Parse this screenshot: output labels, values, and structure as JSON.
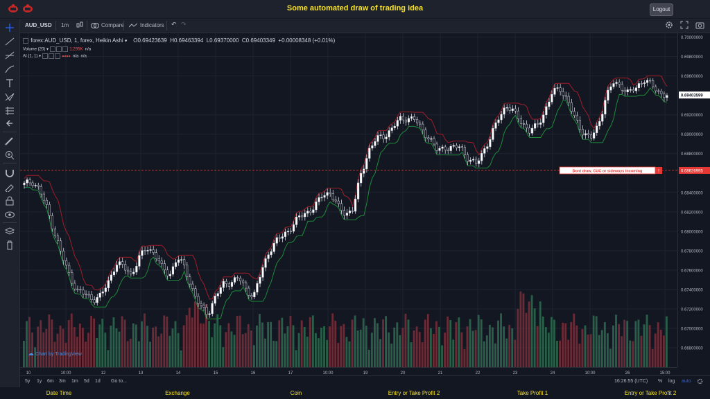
{
  "header": {
    "title": "Some automated draw of trading idea",
    "logout_label": "Logout"
  },
  "toolbar": {
    "symbol": "AUD_USD",
    "interval": "1m",
    "compare_label": "Compare",
    "indicators_label": "Indicators"
  },
  "legend": {
    "main": "forex:AUD_USD, 1, forex, Heikin Ashi",
    "o_label": "O",
    "o": "0.69423639",
    "h_label": "H",
    "h": "0.69463394",
    "l_label": "L",
    "l": "0.69370000",
    "c_label": "C",
    "c": "0.69403349",
    "change": "+0.00008348 (+0.01%)",
    "volume_label": "Volume (20)",
    "volume_value": "1.295K",
    "na1": "n/a",
    "ai_label": "AI (1, 1)",
    "na2": "n/a",
    "na3": "n/a"
  },
  "annotation": {
    "text": "Dont draw, CUC or sideways incoming",
    "price": "0.68626995"
  },
  "price_axis": {
    "labels": [
      "0.70000000",
      "0.69800000",
      "0.69600000",
      "0.69200000",
      "0.69000000",
      "0.68800000",
      "0.68400000",
      "0.68200000",
      "0.68000000",
      "0.67800000",
      "0.67600000",
      "0.67400000",
      "0.67200000",
      "0.67000000",
      "0.66800000"
    ],
    "current": "0.69403599",
    "annotation_level": "0.68626995"
  },
  "time_axis": {
    "labels": [
      "10",
      "10:00",
      "12",
      "13",
      "14",
      "15",
      "16",
      "17",
      "10:00",
      "19",
      "20",
      "21",
      "22",
      "23",
      "24",
      "10:00",
      "26",
      "15:00"
    ]
  },
  "bottombar": {
    "ranges": [
      "5y",
      "1y",
      "6m",
      "3m",
      "1m",
      "5d",
      "1d"
    ],
    "goto_label": "Go to...",
    "time": "16:26:55 (UTC)",
    "pct": "%",
    "log": "log",
    "auto": "auto"
  },
  "watermark": "Chart by TradingView",
  "footer": {
    "items": [
      "Date Time",
      "Exchange",
      "Coin",
      "Entry or Take Profit 2",
      "Take Profit 1",
      "Entry or Take Profit 2"
    ]
  },
  "colors": {
    "up": "#26a69a",
    "down": "#ef5350",
    "vol_up": "#2e6b4f",
    "vol_down": "#7a2e3a",
    "title": "#f7e22b",
    "annotation": "#e53935"
  },
  "chart_data": {
    "type": "candlestick",
    "ylim": [
      0.666,
      0.7004
    ],
    "annotation_level": 0.68626995,
    "x_labels": [
      "10",
      "10:00",
      "12",
      "13",
      "14",
      "15",
      "16",
      "17",
      "10:00",
      "19",
      "20",
      "21",
      "22",
      "23",
      "24",
      "10:00",
      "26",
      "15:00"
    ],
    "closes": [
      0.6848,
      0.6852,
      0.6843,
      0.6823,
      0.6798,
      0.6773,
      0.6753,
      0.6738,
      0.6735,
      0.673,
      0.6733,
      0.6748,
      0.6767,
      0.6763,
      0.6755,
      0.6772,
      0.6783,
      0.6778,
      0.6762,
      0.6755,
      0.6773,
      0.6762,
      0.674,
      0.6722,
      0.6715,
      0.6733,
      0.6745,
      0.6748,
      0.6752,
      0.674,
      0.6733,
      0.6758,
      0.678,
      0.679,
      0.6797,
      0.6805,
      0.6815,
      0.682,
      0.6825,
      0.6838,
      0.684,
      0.6825,
      0.6818,
      0.6823,
      0.6858,
      0.6883,
      0.6895,
      0.6898,
      0.6905,
      0.6915,
      0.6917,
      0.6915,
      0.6905,
      0.6895,
      0.6883,
      0.6887,
      0.6885,
      0.6888,
      0.6875,
      0.6868,
      0.6883,
      0.6897,
      0.6917,
      0.693,
      0.6922,
      0.6913,
      0.6903,
      0.6908,
      0.6923,
      0.6942,
      0.6948,
      0.6935,
      0.6915,
      0.6903,
      0.6895,
      0.6908,
      0.6938,
      0.6953,
      0.695,
      0.6942,
      0.6948,
      0.6957,
      0.695,
      0.6943,
      0.694
    ]
  }
}
